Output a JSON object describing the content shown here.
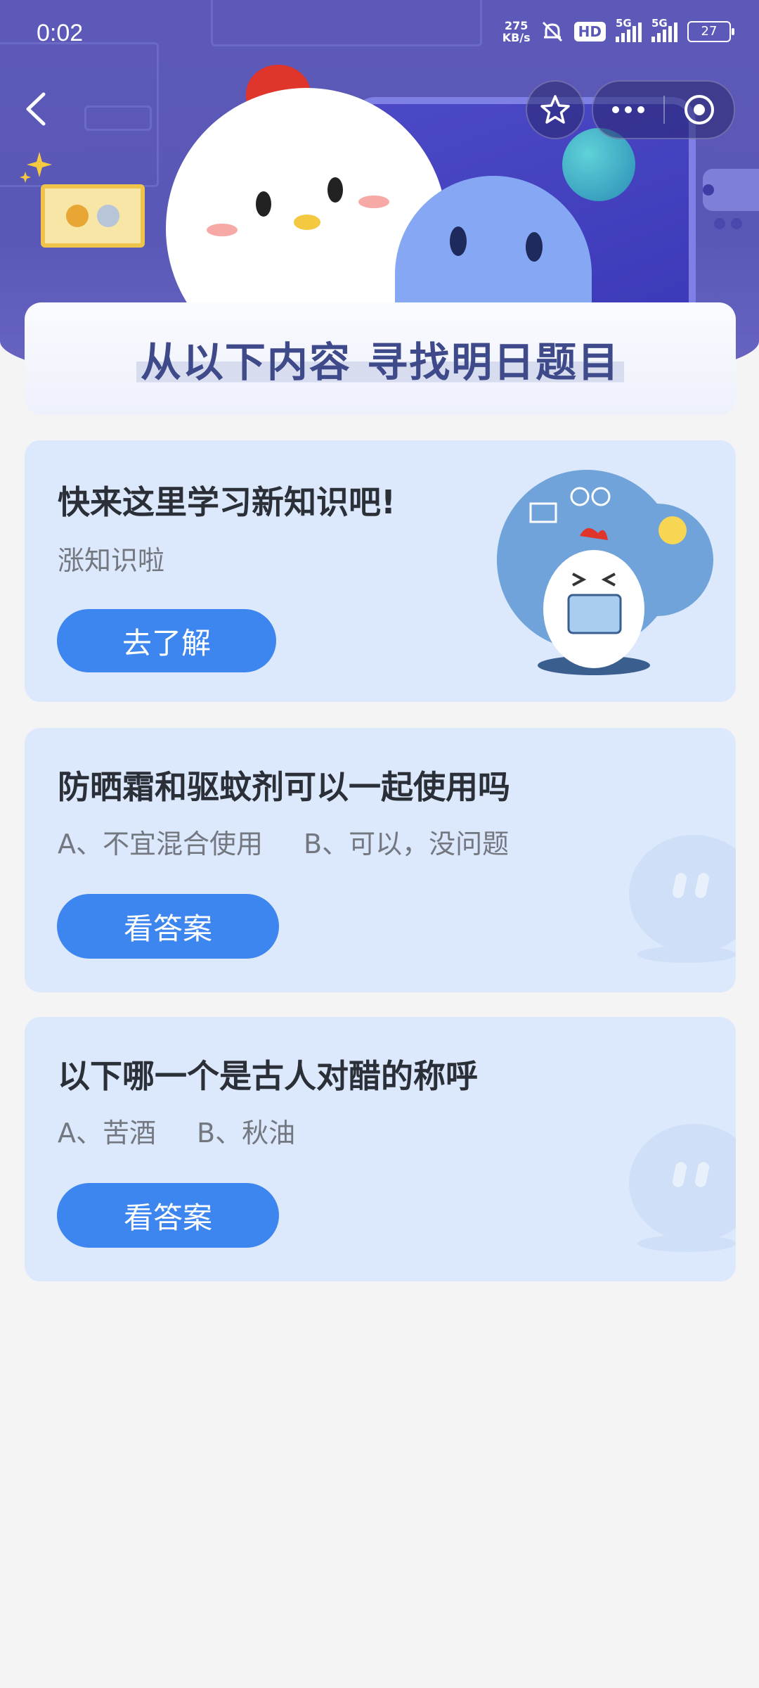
{
  "status_bar": {
    "time": "0:02",
    "speed_value": "275",
    "speed_unit": "KB/s",
    "hd": "HD",
    "net1": "5G",
    "net2": "5G",
    "battery": "27"
  },
  "banner": {
    "title": "从以下内容 寻找明日题目"
  },
  "learn_card": {
    "title": "快来这里学习新知识吧!",
    "subtitle": "涨知识啦",
    "button": "去了解"
  },
  "questions": [
    {
      "title": "防晒霜和驱蚊剂可以一起使用吗",
      "option_a": "A、不宜混合使用",
      "option_b": "B、可以，没问题",
      "button": "看答案"
    },
    {
      "title": "以下哪一个是古人对醋的称呼",
      "option_a": "A、苦酒",
      "option_b": "B、秋油",
      "button": "看答案"
    }
  ],
  "colors": {
    "header": "#5a58b6",
    "primary_button": "#3d86f0",
    "card_background": "#dce8fb",
    "page_background": "#f4f4f5"
  },
  "icons": [
    "back-arrow-icon",
    "star-icon",
    "more-icon",
    "target-icon",
    "mute-bell-icon",
    "chat-bubble-icon"
  ]
}
